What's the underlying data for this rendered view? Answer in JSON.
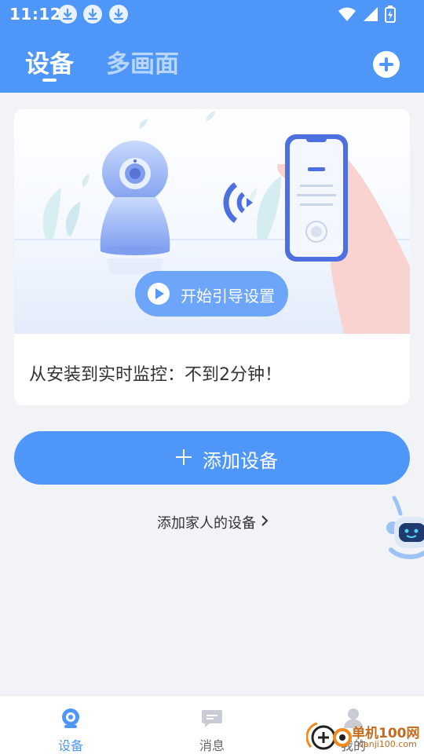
{
  "status_bar": {
    "time": "11:12",
    "icons": [
      "download-icon",
      "download-icon",
      "download-icon",
      "wifi-icon",
      "signal-icon",
      "battery-charging-icon"
    ]
  },
  "header": {
    "tabs": [
      {
        "label": "设备",
        "active": true
      },
      {
        "label": "多画面",
        "active": false
      }
    ],
    "add_icon": "plus-circle-icon"
  },
  "guide": {
    "button_label": "开始引导设置",
    "caption": "从安装到实时监控：不到2分钟！"
  },
  "add_device": {
    "label": "添加设备"
  },
  "family_link": {
    "label": "添加家人的设备"
  },
  "bottom_nav": {
    "items": [
      {
        "label": "设备",
        "icon": "camera-icon",
        "active": true
      },
      {
        "label": "消息",
        "icon": "message-icon",
        "active": false
      },
      {
        "label": "我的",
        "icon": "person-icon",
        "active": false
      }
    ]
  },
  "watermark": {
    "text": "单机100网",
    "sub": "danji100.com"
  },
  "colors": {
    "primary": "#4e97f8",
    "background": "#f2f3f7",
    "tab_inactive": "#b9d6ff"
  }
}
